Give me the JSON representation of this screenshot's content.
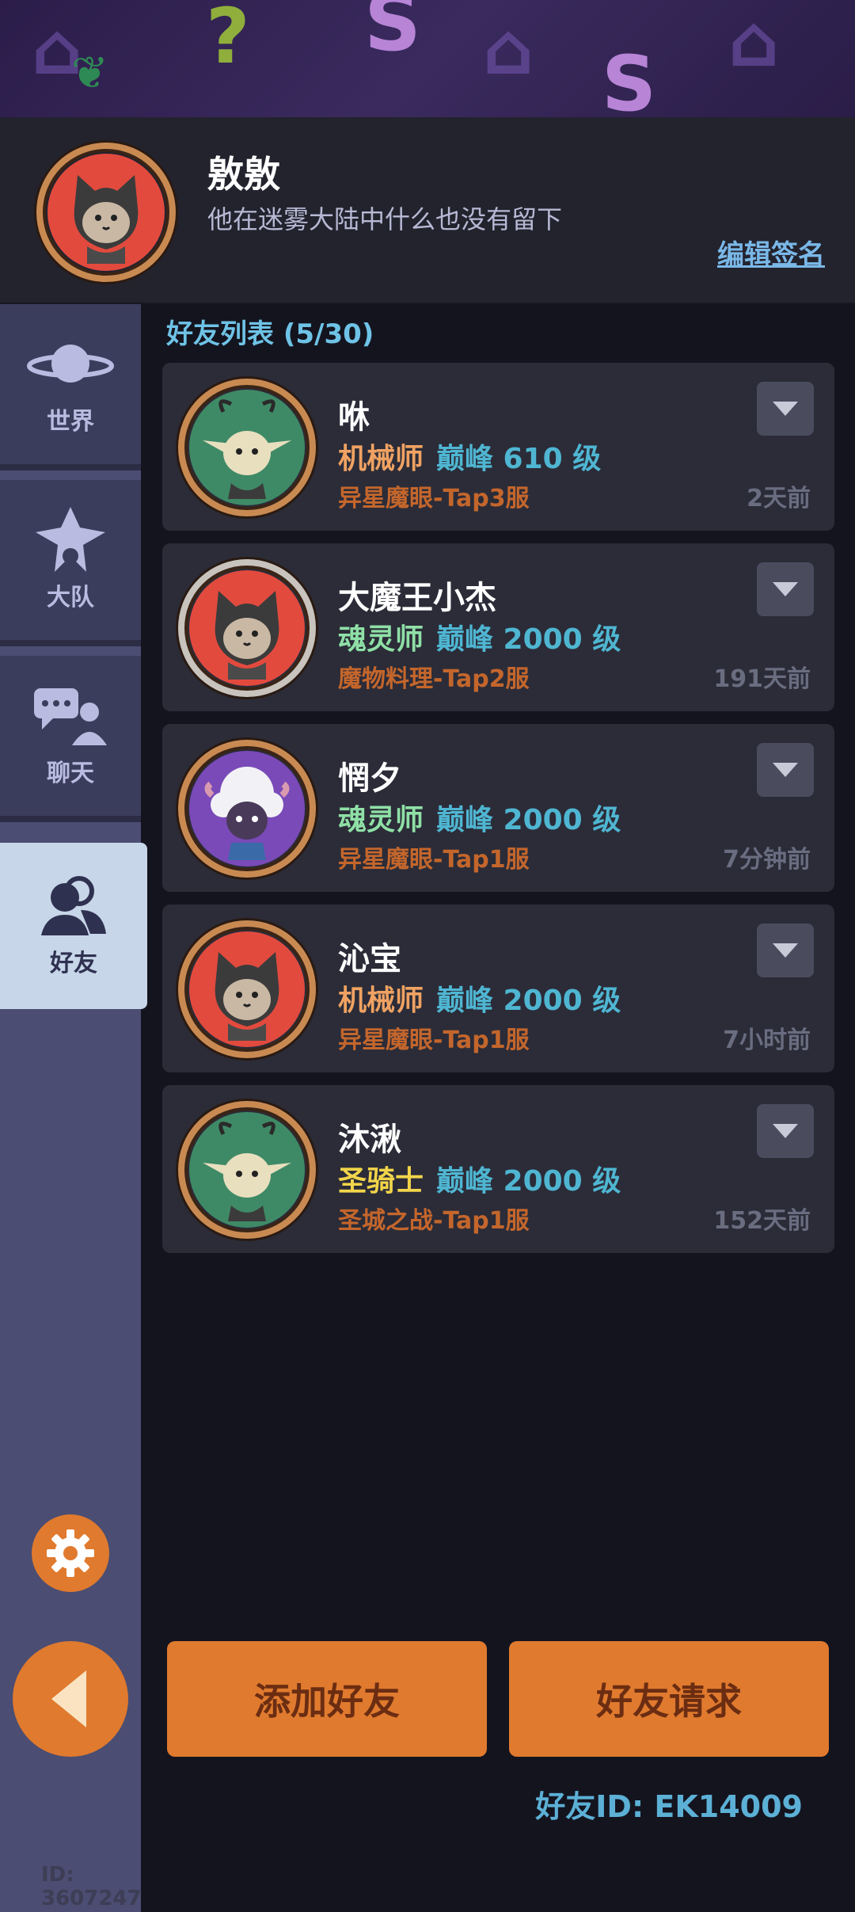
{
  "profile": {
    "name": "敫敫",
    "signature": "他在迷雾大陆中什么也没有留下",
    "edit_signature": "编辑签名"
  },
  "sidebar": {
    "items": [
      {
        "label": "世界",
        "icon": "planet-icon"
      },
      {
        "label": "大队",
        "icon": "team-flag-icon"
      },
      {
        "label": "聊天",
        "icon": "chat-icon"
      },
      {
        "label": "好友",
        "icon": "friends-icon"
      }
    ],
    "settings_icon": "gear-icon",
    "back_icon": "back-arrow-icon",
    "uid": "ID: 3607247"
  },
  "friends": {
    "title": "好友列表 (5/30)",
    "list": [
      {
        "name": "咻",
        "class": "机械师",
        "class_color": "#f0a262",
        "level": "巅峰 610 级",
        "server": "异星魔眼-Tap3服",
        "time": "2天前",
        "avatar": "elf-avatar"
      },
      {
        "name": "大魔王小杰",
        "class": "魂灵师",
        "class_color": "#8fe0a6",
        "level": "巅峰 2000 级",
        "server": "魔物料理-Tap2服",
        "time": "191天前",
        "avatar": "cat-avatar"
      },
      {
        "name": "惘夕",
        "class": "魂灵师",
        "class_color": "#8fe0a6",
        "level": "巅峰 2000 级",
        "server": "异星魔眼-Tap1服",
        "time": "7分钟前",
        "avatar": "sheep-avatar"
      },
      {
        "name": "沁宝",
        "class": "机械师",
        "class_color": "#f0a262",
        "level": "巅峰 2000 级",
        "server": "异星魔眼-Tap1服",
        "time": "7小时前",
        "avatar": "cat-avatar"
      },
      {
        "name": "沐湫",
        "class": "圣骑士",
        "class_color": "#f2d54a",
        "level": "巅峰 2000 级",
        "server": "圣城之战-Tap1服",
        "time": "152天前",
        "avatar": "elf-avatar"
      }
    ]
  },
  "actions": {
    "add_friend": "添加好友",
    "friend_requests": "好友请求"
  },
  "friend_id": "好友ID: EK14009"
}
